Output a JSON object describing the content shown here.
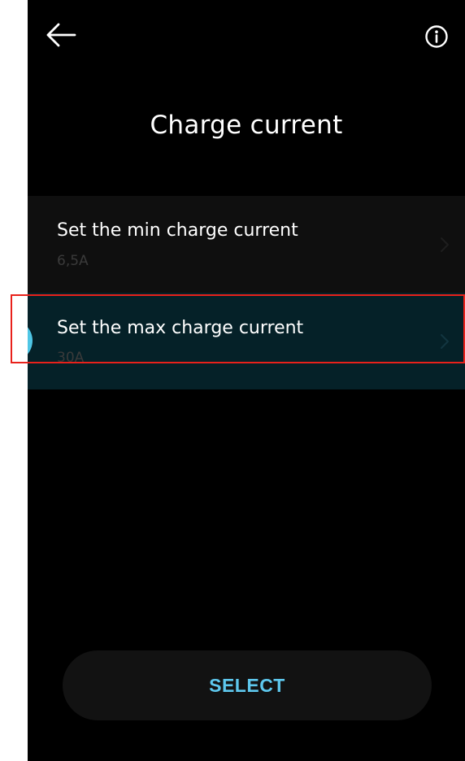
{
  "header": {
    "title": "Charge current",
    "back_icon": "arrow-left-icon",
    "info_icon": "info-circle-icon"
  },
  "settings": [
    {
      "label": "Set the min charge current",
      "value": "6,5A"
    },
    {
      "label": "Set the max charge current",
      "value": "30A"
    }
  ],
  "actions": {
    "select_label": "SELECT"
  },
  "colors": {
    "background": "#000000",
    "accent": "#5ec8ee",
    "selected_row": "#052128",
    "highlight": "#e8211b"
  }
}
